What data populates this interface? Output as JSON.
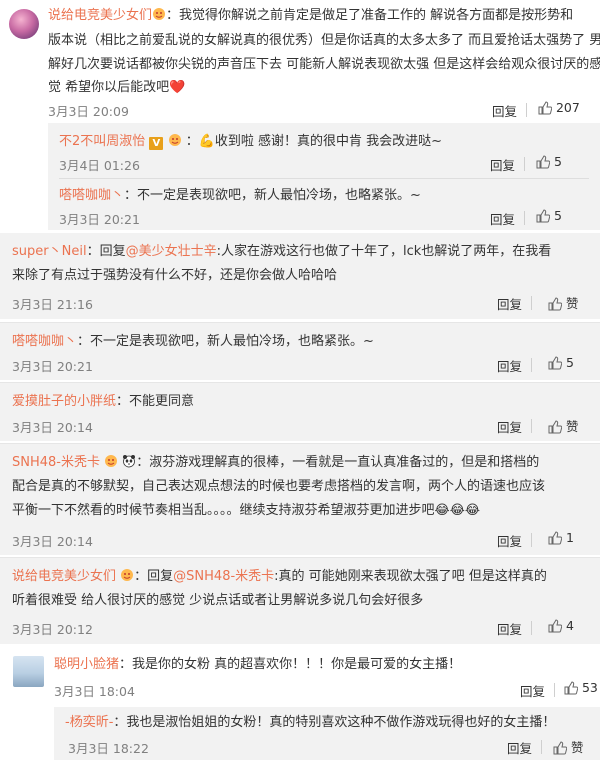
{
  "comments": [
    {
      "user": "说给电竞美少女们",
      "text_line1": "：我觉得你解说之前肯定是做足了准备工作的 解说各方面都是按形势和",
      "text_line2": "版本说（相比之前爱乱说的女解说真的很优秀）但是你话真的太多太多了 而且爱抢话太强势了 男",
      "text_line3": "解好几次要说话都被你尖锐的声音压下去 可能新人解说表现欲太强 但是这样会给观众很讨厌的感",
      "text_line4": "觉 希望你以后能改吧",
      "emoji": "❤️",
      "time": "3月3日 20:09",
      "reply": "回复",
      "likes": "207"
    },
    {
      "user": "不2不叫周淑怡",
      "text": "收到啦 感谢！真的很中肯 我会改进哒~",
      "time": "3月4日 01:26",
      "reply": "回复",
      "likes": "5"
    },
    {
      "user": "嗒嗒咖咖丶",
      "text": "：不一定是表现欲吧，新人最怕冷场，也略紧张。~",
      "time": "3月3日 20:21",
      "reply": "回复",
      "likes": "5"
    },
    {
      "user": "super丶Neil",
      "text_pre": "：回复",
      "mention": "@美少女壮士辛",
      "text_line1": ":人家在游戏这行也做了十年了，lck也解说了两年，在我看",
      "text_line2": "来除了有点过于强势没有什么不好，还是你会做人哈哈哈",
      "time": "3月3日 21:16",
      "reply": "回复",
      "likes": "赞"
    },
    {
      "user": "嗒嗒咖咖丶",
      "text": "：不一定是表现欲吧，新人最怕冷场，也略紧张。~",
      "time": "3月3日 20:21",
      "reply": "回复",
      "likes": "5"
    },
    {
      "user": "爱摸肚子的小胖纸",
      "text": "：不能更同意",
      "time": "3月3日 20:14",
      "reply": "回复",
      "likes": "赞"
    },
    {
      "user": "SNH48-米秃卡",
      "text_line1": "：淑芬游戏理解真的很棒，一看就是一直认真准备过的，但是和搭档的",
      "text_line2": "配合是真的不够默契，自己表达观点想法的时候也要考虑搭档的发言啊，两个人的语速也应该",
      "text_line3": "平衡一下不然看的时候节奏相当乱。。。。继续支持淑芬希望淑芬更加进步吧",
      "emoji": "😂😂😂",
      "time": "3月3日 20:14",
      "reply": "回复",
      "likes": "1"
    },
    {
      "user": "说给电竞美少女们",
      "text_pre": "：回复",
      "mention": "@SNH48-米秃卡",
      "text_line1": ":真的 可能她刚来表现欲太强了吧 但是这样真的",
      "text_line2": "听着很难受 给人很讨厌的感觉 少说点话或者让男解说多说几句会好很多",
      "time": "3月3日 20:12",
      "reply": "回复",
      "likes": "4"
    },
    {
      "user": "聪明小脸猪",
      "text": "：我是你的女粉 真的超喜欢你！！！你是最可爱的女主播！",
      "time": "3月3日 18:04",
      "reply": "回复",
      "likes": "53"
    },
    {
      "user": "-杨奕昕-",
      "text": "：我也是淑怡姐姐的女粉！真的特别喜欢这种不做作游戏玩得也好的女主播！",
      "time": "3月3日 18:22",
      "reply": "回复",
      "likes": "赞"
    }
  ]
}
